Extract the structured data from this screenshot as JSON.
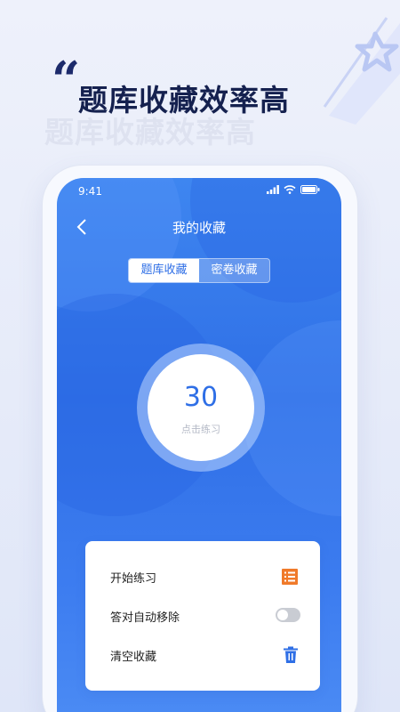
{
  "promo": {
    "title": "题库收藏效率高",
    "quote": "“"
  },
  "status": {
    "time": "9:41"
  },
  "nav": {
    "title": "我的收藏"
  },
  "tabs": [
    {
      "label": "题库收藏",
      "active": true
    },
    {
      "label": "密卷收藏",
      "active": false
    }
  ],
  "counter": {
    "value": "30",
    "label": "点击练习"
  },
  "actions": {
    "start_label": "开始练习",
    "auto_remove_label": "答对自动移除",
    "auto_remove_enabled": false,
    "clear_label": "清空收藏"
  },
  "colors": {
    "primary": "#2f6fe6",
    "accent_orange": "#f07a2a",
    "title": "#15214f"
  }
}
